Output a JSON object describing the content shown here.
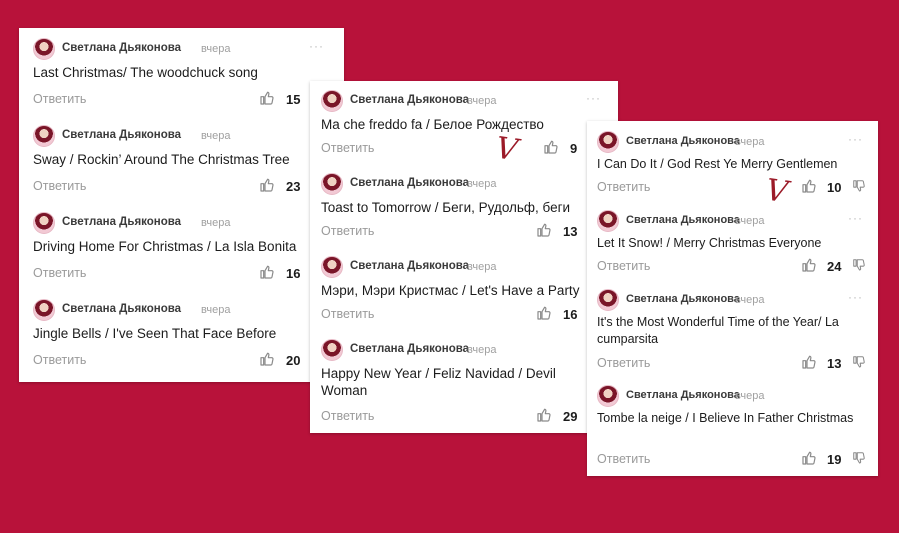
{
  "common": {
    "author": "Светлана Дьяконова",
    "time": "вчера",
    "reply": "Ответить",
    "more": "···"
  },
  "panel1": {
    "comments": [
      {
        "text": "Last Christmas/ The woodchuck song",
        "likes": "15"
      },
      {
        "text": "Sway / Rockin’ Around The Christmas Tree",
        "likes": "23"
      },
      {
        "text": "Driving Home For Christmas / La Isla Bonita",
        "likes": "16"
      },
      {
        "text": "Jingle Bells / I've Seen That Face Before",
        "likes": "20"
      }
    ]
  },
  "panel2": {
    "comments": [
      {
        "text": "Ma che freddo fa / Белое Рождество",
        "likes": "9"
      },
      {
        "text": "Toast to Tomorrow / Беги, Рудольф, беги",
        "likes": "13"
      },
      {
        "text": "Мэри, Мэри Кристмас / Let's Have a Party",
        "likes": "16"
      },
      {
        "text": "Happy New Year / Feliz Navidad / Devil Woman",
        "likes": "29"
      }
    ]
  },
  "panel3": {
    "comments": [
      {
        "text": "I Can Do It / God Rest Ye Merry Gentlemen",
        "likes": "10"
      },
      {
        "text": "Let It Snow! / Merry Christmas Everyone",
        "likes": "24"
      },
      {
        "text": "It's the Most Wonderful Time of the Year/ La cumparsita",
        "likes": "13"
      },
      {
        "text": "Tombe la neige / I Believe In Father Christmas",
        "likes": "19"
      }
    ]
  },
  "marks": {
    "check": "V"
  },
  "colors": {
    "background": "#b8123a",
    "card": "#ffffff",
    "mark": "#9b1a28"
  },
  "icons": [
    "like-icon",
    "dislike-icon",
    "more-options-icon",
    "avatar"
  ]
}
